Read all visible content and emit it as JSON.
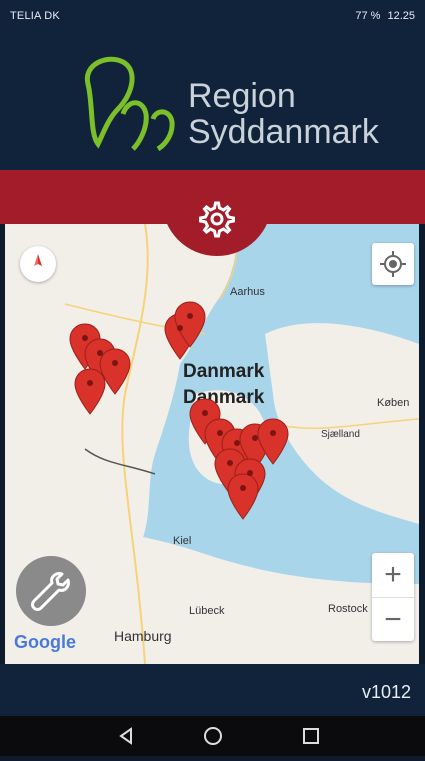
{
  "status_bar": {
    "carrier": "TELIA DK",
    "battery": "77 %",
    "time": "12.25"
  },
  "brand": {
    "line1": "Region",
    "line2": "Syddanmark"
  },
  "map": {
    "labels": {
      "aarhus": "Aarhus",
      "danmark": "Danmark",
      "danmark2": "Danmark",
      "kobenhavn": "Køben",
      "sjaelland": "Sjælland",
      "kiel": "Kiel",
      "lubeck": "Lübeck",
      "rostock": "Rostock",
      "hamburg": "Hamburg"
    },
    "google_mark": "Google",
    "zoom_in": "+",
    "zoom_out": "−"
  },
  "footer": {
    "version": "v1012"
  },
  "colors": {
    "header_bg": "#11233a",
    "accent_red": "#a31c2a",
    "pin_red": "#d8322b"
  },
  "icons": [
    "gear-icon",
    "compass-icon",
    "locate-icon",
    "wrench-icon",
    "back-icon",
    "home-icon",
    "recents-icon"
  ]
}
